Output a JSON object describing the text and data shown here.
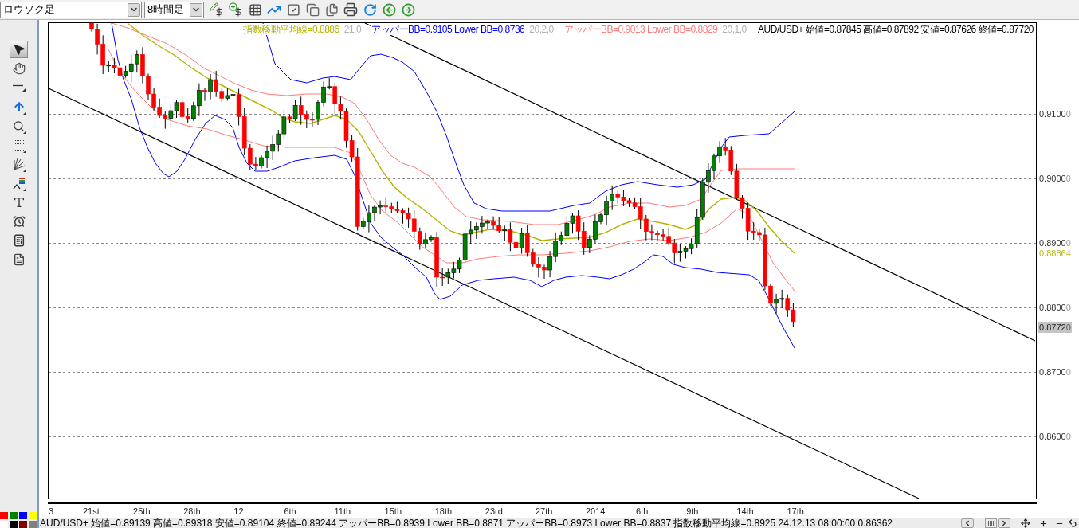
{
  "toolbar": {
    "chart_type": "ロウソク足",
    "timeframe": "8時間足"
  },
  "drawing_tools": [
    {
      "selected": true,
      "submenu": false
    },
    {
      "selected": false,
      "submenu": false
    },
    {
      "selected": false,
      "submenu": true
    },
    {
      "selected": false,
      "submenu": true
    },
    {
      "selected": false,
      "submenu": true
    },
    {
      "selected": false,
      "submenu": true
    },
    {
      "selected": false,
      "submenu": true
    },
    {
      "selected": false,
      "submenu": true
    },
    {
      "selected": false,
      "submenu": false
    },
    {
      "selected": false,
      "submenu": false
    },
    {
      "selected": false,
      "submenu": false
    },
    {
      "selected": false,
      "submenu": false
    }
  ],
  "color_palette": [
    {
      "color": "#ff0000"
    },
    {
      "color": "#008000"
    },
    {
      "color": "#0000ff"
    },
    {
      "color": "#ffff00"
    },
    {
      "color": "#ffffff"
    },
    {
      "color": "#000000"
    },
    {
      "color": "#800000"
    },
    {
      "color": "#808080"
    }
  ],
  "chart": {
    "legend": [
      {
        "text": "指数移動平均線=0.8886",
        "params": "21,0",
        "color": "#b5b500"
      },
      {
        "text": "アッパーBB=0.9105 Lower BB=0.8736",
        "params": "20,2,0",
        "color": "#0000ff"
      },
      {
        "text": "アッパーBB=0.9013 Lower BB=0.8829",
        "params": "20,1,0",
        "color": "#ff7b7b"
      },
      {
        "text": "AUD/USD+ 始値=0.87845 高値=0.87892 安値=0.87626 終値=0.87720",
        "color": "#000000"
      }
    ],
    "price_axis": [
      {
        "value": "0.9100",
        "extra": "0"
      },
      {
        "value": "0.9000",
        "extra": "0"
      },
      {
        "value": "0.8900",
        "extra": "0"
      },
      {
        "value": "0.8800",
        "extra": "0"
      },
      {
        "value": "0.8700",
        "extra": "0"
      },
      {
        "value": "0.8600",
        "extra": "0"
      }
    ],
    "ema_marker": {
      "value": "0.8886",
      "extra": "4"
    },
    "price_marker": {
      "value": "0.8772",
      "extra": "0"
    },
    "time_axis": [
      "3",
      "21st",
      "25th",
      "28th",
      "12",
      "6th",
      "11th",
      "15th",
      "18th",
      "23rd",
      "27th",
      "2014",
      "6th",
      "9th",
      "14th",
      "17th"
    ]
  },
  "status_bar": {
    "quote": "AUD/USD+ 始値=0.89139 高値=0.89318 安値=0.89104 終値=0.89244 アッパーBB=0.8939 Lower BB=0.8871 アッパーBB=0.8973 Lower BB=0.8837 指数移動平均線=0.8925 24.12.13 08:00:00 0.86362"
  }
}
